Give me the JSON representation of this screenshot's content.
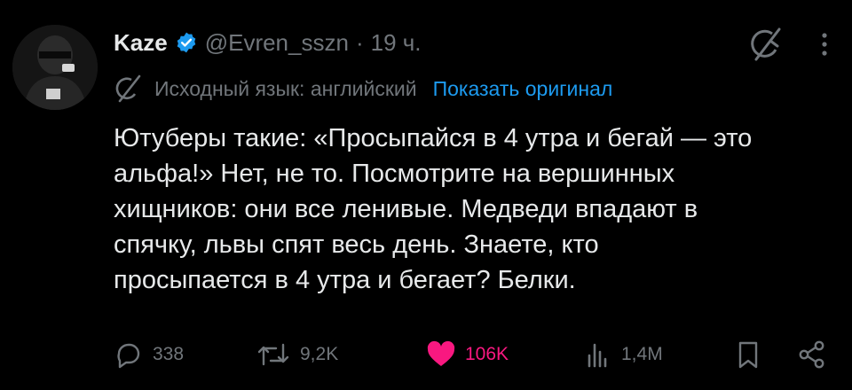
{
  "tweet": {
    "author_name": "Kaze",
    "handle": "@Evren_sszn",
    "separator": "·",
    "time": "19 ч.",
    "translation": {
      "label": "Исходный язык: английский",
      "show_original": "Показать оригинал"
    },
    "lines": [
      "Ютуберы такие: «Просыпайся в 4 утра и бегай — это",
      "альфа!» Нет, не то. Посмотрите на вершинных",
      "хищников: они все ленивые. Медведи впадают в",
      "спячку, львы спят весь день. Знаете, кто",
      "просыпается в 4 утра и бегает? Белки."
    ],
    "stats": {
      "replies": "338",
      "reposts": "9,2K",
      "likes": "106K",
      "views": "1,4M"
    }
  },
  "colors": {
    "background": "#000000",
    "text": "#e7e9ea",
    "secondary": "#71767b",
    "link": "#1d9bf0",
    "like": "#f91880",
    "verified": "#1d9bf0"
  },
  "icons": {
    "verified": "verified-badge-icon",
    "grok": "grok-icon",
    "more": "more-icon",
    "translate": "translate-icon",
    "reply": "reply-icon",
    "repost": "repost-icon",
    "like": "heart-icon",
    "views": "views-icon",
    "bookmark": "bookmark-icon",
    "share": "share-icon"
  }
}
